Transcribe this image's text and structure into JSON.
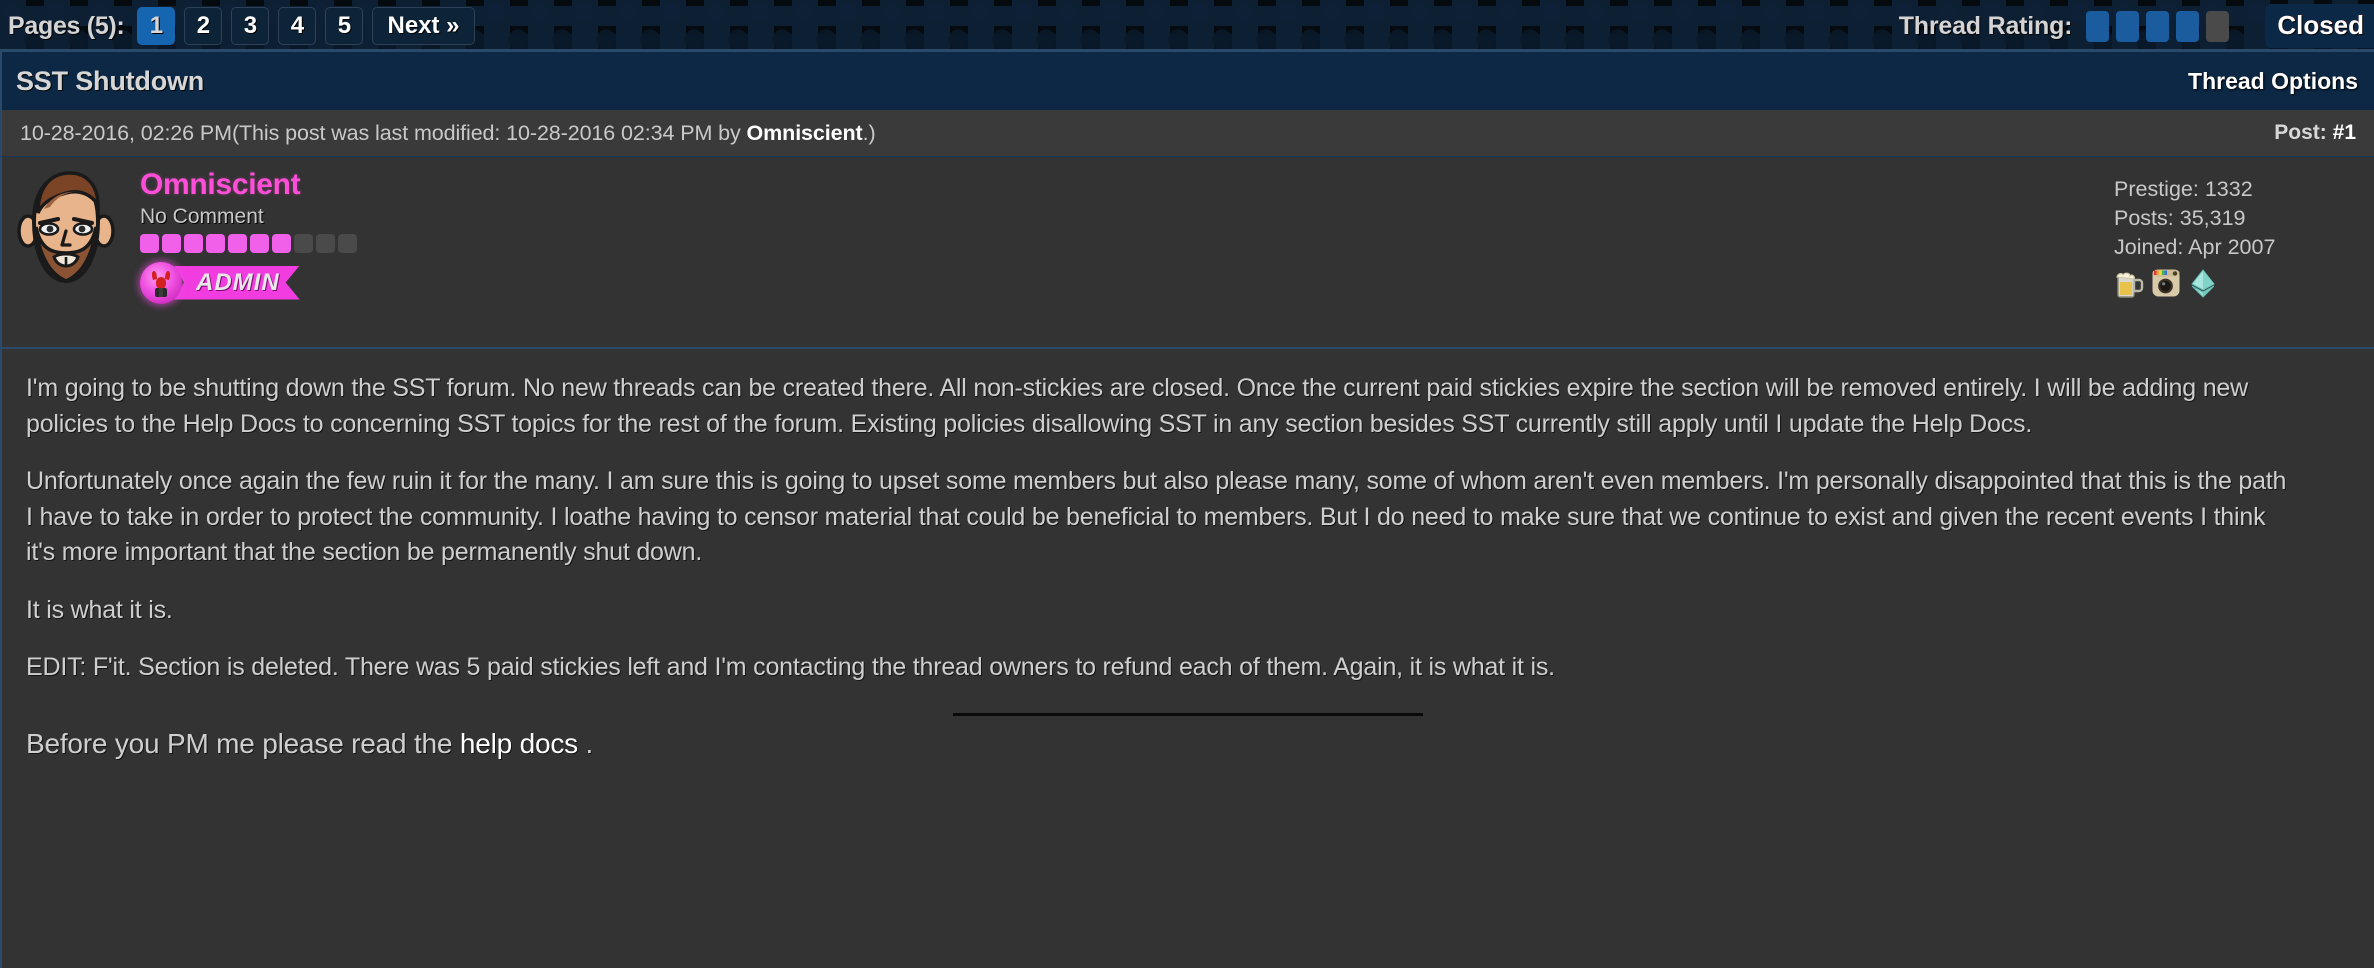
{
  "topbar": {
    "pages_label": "Pages (5):",
    "pages": [
      {
        "label": "1",
        "current": true
      },
      {
        "label": "2",
        "current": false
      },
      {
        "label": "3",
        "current": false
      },
      {
        "label": "4",
        "current": false
      },
      {
        "label": "5",
        "current": false
      }
    ],
    "next_label": "Next »",
    "rating_label": "Thread Rating:",
    "rating_value": 4,
    "rating_max": 5,
    "closed_label": "Closed",
    "accent_current_page": "#1565b0",
    "accent_star_on": "#1a5c9e",
    "accent_star_off": "#4a4a4a"
  },
  "thread": {
    "title": "SST Shutdown",
    "options_label": "Thread Options",
    "titlebar_color": "#0d2845"
  },
  "post": {
    "date": "10-28-2016, 02:26 PM",
    "modified_prefix": "(This post was last modified: ",
    "modified_date": "10-28-2016 02:34 PM",
    "modified_by_prefix": " by ",
    "modified_by": "Omniscient",
    "modified_suffix": ".)",
    "post_label": "Post: ",
    "post_number": "#1"
  },
  "author": {
    "username": "Omniscient",
    "username_color": "#ff4fd8",
    "usertitle": "No Comment",
    "reputation_filled": 7,
    "reputation_total": 10,
    "reputation_color": "#f060e8",
    "group_label": "ADMIN",
    "group_color": "#f13ce0",
    "avatar_alt": "avatar-bearded-man",
    "stats": [
      {
        "label": "Prestige:",
        "value": "1332"
      },
      {
        "label": "Posts:",
        "value": "35,319"
      },
      {
        "label": "Joined:",
        "value": "Apr 2007"
      }
    ],
    "badges": [
      "beer-mug-icon",
      "instagram-camera-icon",
      "ethereum-diamond-icon"
    ]
  },
  "body": {
    "paragraphs": [
      "I'm going to be shutting down the SST forum. No new threads can be created there. All non-stickies are closed. Once the current paid stickies expire the section will be removed entirely. I will be adding new policies to the Help Docs to concerning SST topics for the rest of the forum. Existing policies disallowing SST in any section besides SST currently still apply until I update the Help Docs.",
      "Unfortunately once again the few ruin it for the many. I am sure this is going to upset some members but also please many, some of whom aren't even members. I'm personally disappointed that this is the path I have to take in order to protect the community. I loathe having to censor material that could be beneficial to members. But I do need to make sure that we continue to exist and given the recent events I think it's more important that the section be permanently shut down.",
      "It is what it is.",
      "EDIT: F'it. Section is deleted. There was 5 paid stickies left and I'm contacting the thread owners to refund each of them. Again, it is what it is."
    ],
    "signature_prefix": "Before you PM me please read the ",
    "signature_link": "help docs",
    "signature_suffix": " ."
  }
}
